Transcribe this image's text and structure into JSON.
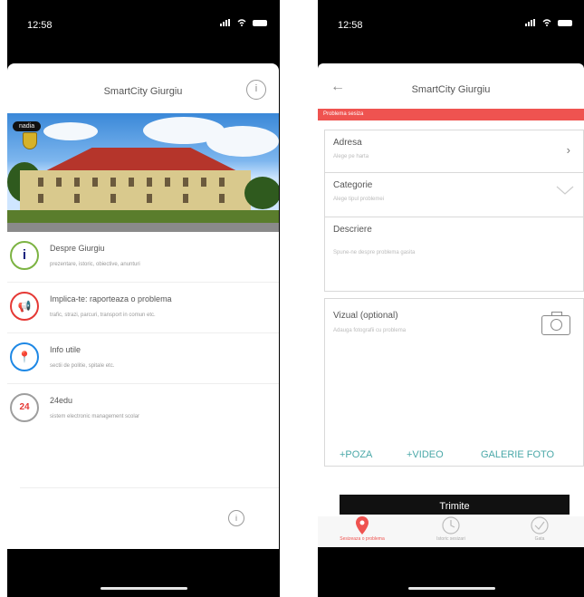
{
  "status_bar": {
    "time": "12:58"
  },
  "left_screen": {
    "title": "SmartCity Giurgiu",
    "info_glyph": "i",
    "hero_badge": "nadia",
    "menu_items": [
      {
        "title": "Despre Giurgiu",
        "subtitle": "prezentare, istoric, obiective, anunturi",
        "icon_glyph": "i",
        "color": "#7cb342"
      },
      {
        "title": "Implica-te: raporteaza o problema",
        "subtitle": "trafic, strazi, parcuri, transport in comun etc.",
        "icon_glyph": "📢",
        "color": "#e53935"
      },
      {
        "title": "Info utile",
        "subtitle": "sectii de politie, spitale etc.",
        "icon_glyph": "📍",
        "color": "#1e88e5"
      },
      {
        "title": "24edu",
        "subtitle": "sistem electronic management scolar",
        "icon_glyph": "24",
        "color": "#9e9e9e"
      }
    ]
  },
  "right_screen": {
    "title": "SmartCity Giurgiu",
    "alert_strip": "Problema sesiza",
    "fields": {
      "address": {
        "label": "Adresa",
        "hint": "Alege pe harta"
      },
      "category": {
        "label": "Categorie",
        "hint": "Alege tipul problemei"
      },
      "description": {
        "label": "Descriere",
        "hint": "Spune-ne despre problema gasita"
      },
      "visual": {
        "label": "Vizual (optional)",
        "hint": "Adauga fotografii cu problema"
      }
    },
    "media_actions": {
      "photo": "+POZA",
      "video": "+VIDEO",
      "gallery": "GALERIE FOTO"
    },
    "submit_label": "Trimite",
    "tabs": [
      {
        "label": "Sesizeaza o problema",
        "icon": "map-pin-icon",
        "active": true
      },
      {
        "label": "Istoric sesizari",
        "icon": "clock-icon",
        "active": false
      },
      {
        "label": "Gata",
        "icon": "check-circle-icon",
        "active": false
      }
    ]
  },
  "colors": {
    "accent_red": "#ef5350",
    "link_teal": "#4aa8a8",
    "phone_bg": "#000000"
  }
}
